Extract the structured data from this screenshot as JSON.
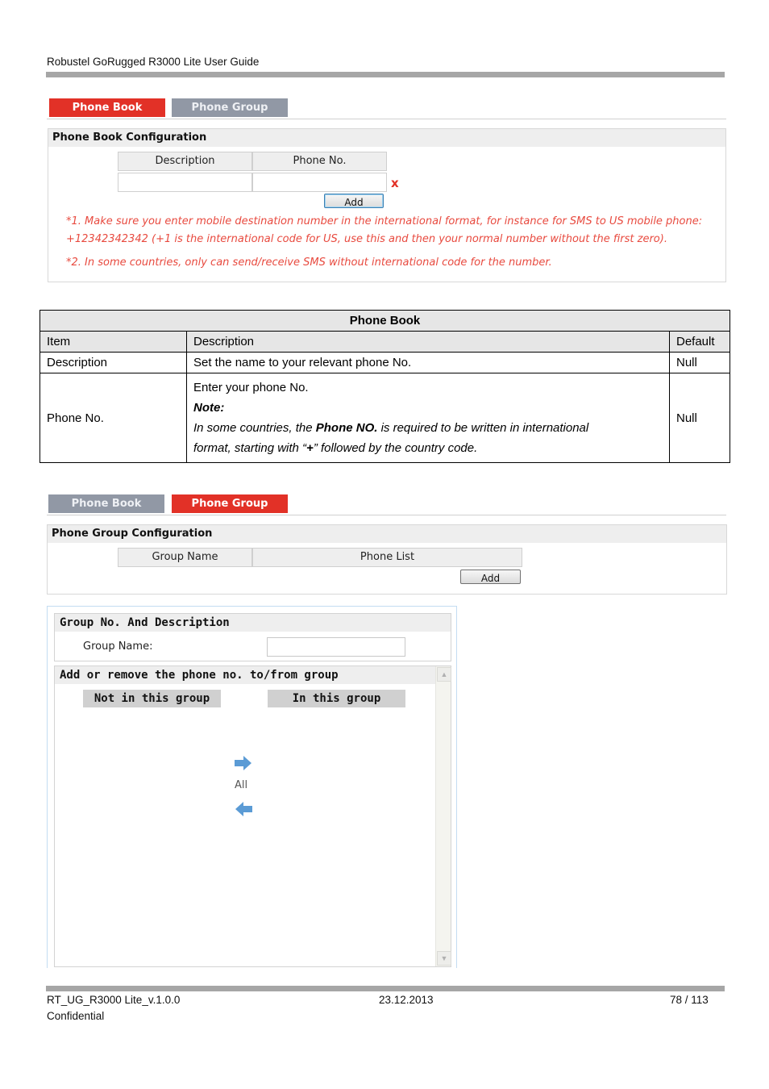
{
  "document": {
    "header_title": "Robustel GoRugged R3000 Lite User Guide",
    "footer": {
      "doc_id": "RT_UG_R3000 Lite_v.1.0.0",
      "date": "23.12.2013",
      "page": "78 / 113",
      "classification": "Confidential"
    }
  },
  "phone_book_screen": {
    "tabs": [
      {
        "label": "Phone Book",
        "active": true
      },
      {
        "label": "Phone Group",
        "active": false
      }
    ],
    "panel_title": "Phone Book Configuration",
    "columns": [
      "Description",
      "Phone No."
    ],
    "row": {
      "description_value": "",
      "phone_value": ""
    },
    "delete_icon": "x",
    "add_button": "Add",
    "notes": [
      "*1. Make sure you enter mobile destination number in the international format, for instance for SMS to US mobile phone:",
      "+12342342342 (+1 is the international code for US, use this and then your normal number without the first zero).",
      "*2. In some countries, only can send/receive SMS without international code for the number."
    ]
  },
  "phone_book_table": {
    "title": "Phone Book",
    "headers": [
      "Item",
      "Description",
      "Default"
    ],
    "rows": [
      {
        "item": "Description",
        "description": "Set the name to your relevant phone No.",
        "default": "Null"
      },
      {
        "item": "Phone No.",
        "description_line1": "Enter your phone No.",
        "note_label": "Note:",
        "note_pre": "In some countries, the ",
        "note_bold": "Phone NO.",
        "note_post": " is required to be written in international",
        "note_line2_pre": "format, starting with “",
        "note_line2_bold": "+",
        "note_line2_post": "” followed by the country code.",
        "default": "Null"
      }
    ]
  },
  "phone_group_screen": {
    "tabs": [
      {
        "label": "Phone Book",
        "active": false
      },
      {
        "label": "Phone Group",
        "active": true
      }
    ],
    "panel_title": "Phone Group Configuration",
    "columns": [
      "Group Name",
      "Phone List"
    ],
    "add_button": "Add",
    "dialog": {
      "section1_title": "Group No. And Description",
      "group_name_label": "Group Name:",
      "group_name_value": "",
      "section2_title": "Add or remove the phone no. to/from group",
      "not_in_group_label": "Not in this group",
      "in_group_label": "In this group",
      "all_label": "All",
      "accent_color": "#5b9bd5"
    }
  },
  "colors": {
    "tab_active": "#e23127",
    "tab_inactive": "#9198a5",
    "note_text": "#e84a3f"
  }
}
